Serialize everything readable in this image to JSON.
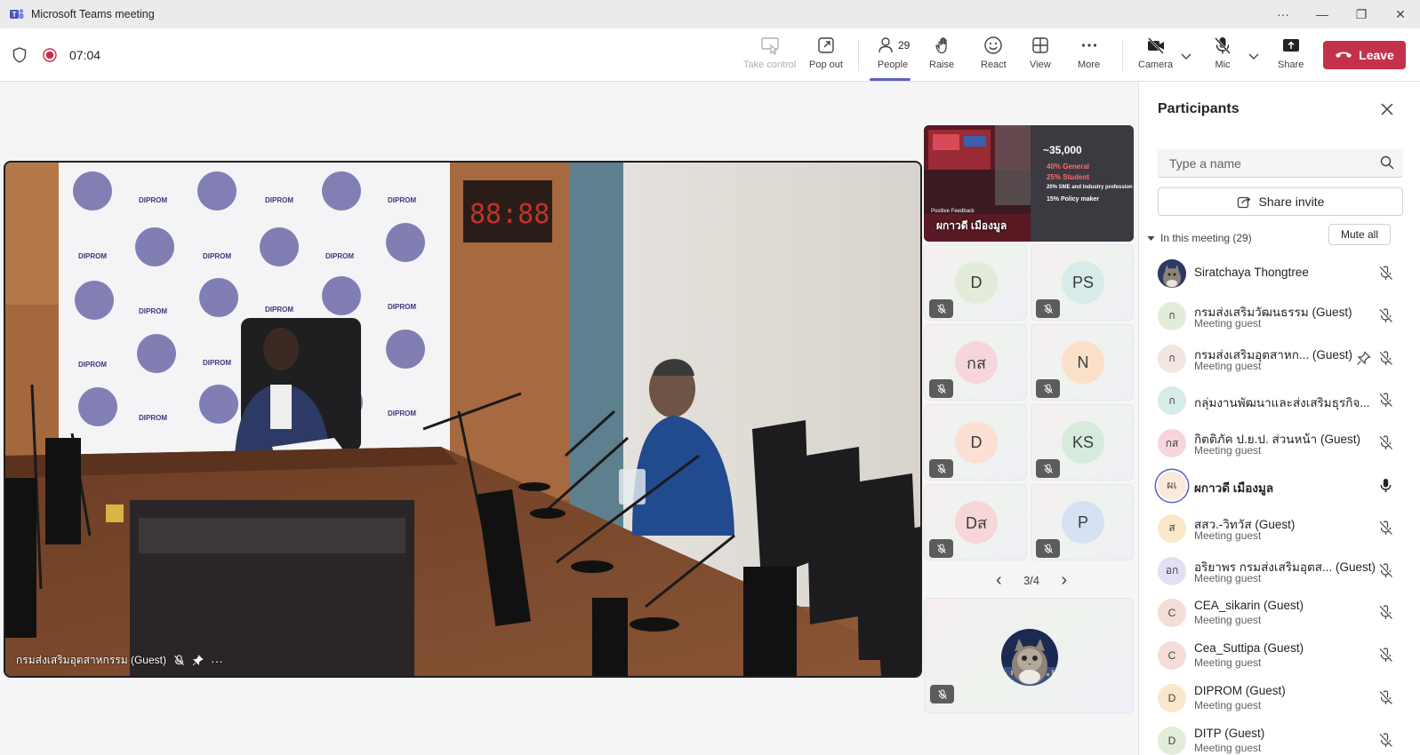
{
  "window": {
    "title": "Microsoft Teams meeting",
    "more": "···",
    "minimize": "—",
    "restore": "❐",
    "close": "✕"
  },
  "toolbar": {
    "timer": "07:04",
    "take_control": "Take control",
    "pop_out": "Pop out",
    "people": "People",
    "people_count": "29",
    "raise": "Raise",
    "react": "React",
    "view": "View",
    "more": "More",
    "camera": "Camera",
    "mic": "Mic",
    "share": "Share",
    "leave": "Leave",
    "colors": {
      "accent": "#5b5fc7",
      "leave": "#c4314b"
    }
  },
  "stage": {
    "name": "กรมส่งเสริมอุตสาหกรรม (Guest)",
    "more": "···"
  },
  "gallery": {
    "top_tile_name": "ผกาวดี เมืองมูล",
    "slide": {
      "headline": "~35,000",
      "l1": "40% General",
      "l2": "25% Student",
      "l3": "20% SME and Industry profession",
      "l4": "15% Policy maker",
      "footer": "Positive Feedback"
    },
    "tiles": [
      {
        "initials": "D",
        "color": "#e3ecd9",
        "fg": "#3b3b3b"
      },
      {
        "initials": "PS",
        "color": "#d7ebe9",
        "fg": "#3b3b3b"
      },
      {
        "initials": "กส",
        "color": "#f6d6dc",
        "fg": "#3b3b3b"
      },
      {
        "initials": "N",
        "color": "#fbe0c9",
        "fg": "#3b3b3b"
      },
      {
        "initials": "D",
        "color": "#fbe0d3",
        "fg": "#3b3b3b"
      },
      {
        "initials": "KS",
        "color": "#d7ebdc",
        "fg": "#3b3b3b"
      },
      {
        "initials": "Dส",
        "color": "#f6d6d6",
        "fg": "#3b3b3b"
      },
      {
        "initials": "P",
        "color": "#d6e2f4",
        "fg": "#3b3b3b"
      }
    ],
    "pager": {
      "prev": "‹",
      "label": "3/4",
      "next": "›"
    }
  },
  "panel": {
    "title": "Participants",
    "search_placeholder": "Type a name",
    "share_invite": "Share invite",
    "in_meeting": "In this meeting (29)",
    "mute_all": "Mute all",
    "participants": [
      {
        "initials": "",
        "name": "Siratchaya Thongtree",
        "sub": "",
        "avatar_color": "#44516b",
        "mic": "off",
        "bold": false,
        "photo": true
      },
      {
        "initials": "ก",
        "name": "กรมส่งเสริมวัฒนธรรม (Guest)",
        "sub": "Meeting guest",
        "avatar_color": "#e3ecd9",
        "mic": "off",
        "bold": false
      },
      {
        "initials": "ก",
        "name": "กรมส่งเสริมอุตสาหก... (Guest)",
        "sub": "Meeting guest",
        "avatar_color": "#f3e6e0",
        "mic": "off",
        "bold": false,
        "pinned": true
      },
      {
        "initials": "ก",
        "name": "กลุ่มงานพัฒนาและส่งเสริมธุรกิจ...",
        "sub": "",
        "avatar_color": "#d7ebe9",
        "mic": "off",
        "bold": false
      },
      {
        "initials": "กส",
        "name": "กิตติภัค ป.ย.ป. ส่วนหน้า (Guest)",
        "sub": "Meeting guest",
        "avatar_color": "#f6d6dc",
        "mic": "off",
        "bold": false
      },
      {
        "initials": "ผเ",
        "name": "ผกาวดี เมืองมูล",
        "sub": "",
        "avatar_color": "#fbe9dc",
        "mic": "on",
        "bold": true,
        "speaking": true
      },
      {
        "initials": "ส",
        "name": "สสว.-วิทวัส (Guest)",
        "sub": "Meeting guest",
        "avatar_color": "#fbe7c9",
        "mic": "off",
        "bold": false
      },
      {
        "initials": "อก",
        "name": "อริยาพร กรมส่งเสริมอุตส... (Guest)",
        "sub": "Meeting guest",
        "avatar_color": "#e4e0f3",
        "mic": "off",
        "bold": false
      },
      {
        "initials": "C",
        "name": "CEA_sikarin (Guest)",
        "sub": "Meeting guest",
        "avatar_color": "#f6dcd6",
        "mic": "off",
        "bold": false
      },
      {
        "initials": "C",
        "name": "Cea_Suttipa (Guest)",
        "sub": "Meeting guest",
        "avatar_color": "#f6dcd6",
        "mic": "off",
        "bold": false
      },
      {
        "initials": "D",
        "name": "DIPROM (Guest)",
        "sub": "Meeting guest",
        "avatar_color": "#fbe7c9",
        "mic": "off",
        "bold": false
      },
      {
        "initials": "D",
        "name": "DITP (Guest)",
        "sub": "Meeting guest",
        "avatar_color": "#e3ecd9",
        "mic": "off",
        "bold": false
      }
    ]
  }
}
